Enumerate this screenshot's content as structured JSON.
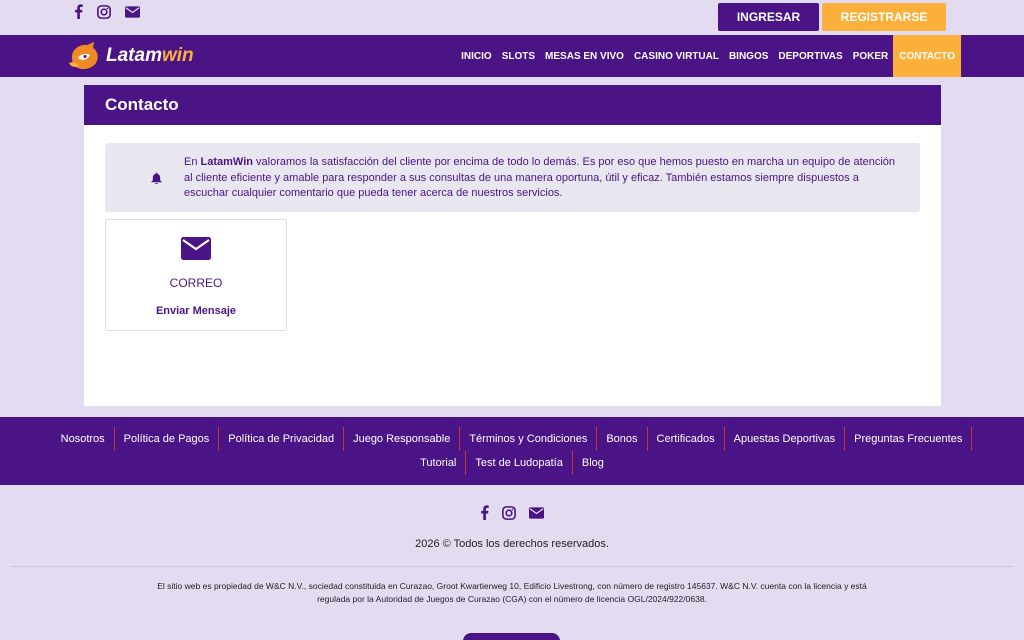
{
  "topbar": {
    "ingresar_label": "INGRESAR",
    "registrarse_label": "REGISTRARSE",
    "social_icons": [
      "facebook-icon",
      "instagram-icon",
      "envelope-icon"
    ]
  },
  "brand": {
    "name_part1": "Latam",
    "name_part2": "win",
    "accent": "#fbb03b",
    "primary": "#4a1487"
  },
  "nav": {
    "items": [
      {
        "label": "INICIO"
      },
      {
        "label": "SLOTS"
      },
      {
        "label": "MESAS EN VIVO"
      },
      {
        "label": "CASINO VIRTUAL"
      },
      {
        "label": "BINGOS"
      },
      {
        "label": "DEPORTIVAS"
      },
      {
        "label": "POKER"
      },
      {
        "label": "CONTACTO",
        "active": true
      }
    ]
  },
  "page": {
    "title": "Contacto",
    "notice_prefix": "En ",
    "notice_brand": "LatamWin",
    "notice_body": " valoramos la satisfacción del cliente por encima de todo lo demás. Es por eso que hemos puesto en marcha un equipo de atención al cliente eficiente y amable para responder a sus consultas de una manera oportuna, útil y eficaz. También estamos siempre dispuestos a escuchar cualquier comentario que pueda tener acerca de nuestros servicios.",
    "contact": {
      "label": "CORREO",
      "action": "Enviar Mensaje"
    }
  },
  "footer": {
    "row1": [
      "Nosotros",
      "Política de Pagos",
      "Política de Privacidad",
      "Juego Responsable",
      "Términos y Condiciones",
      "Bonos",
      "Certificados",
      "Apuestas Deportivas",
      "Preguntas Frecuentes"
    ],
    "row2": [
      "Tutorial",
      "Test de Ludopatía",
      "Blog"
    ],
    "copyright": "2026 © Todos los derechos reservados.",
    "legal": "El sitio web es propiedad de W&C N.V., sociedad constituida en Curazao, Groot Kwartierweg 10, Edificio Livestrong, con número de registro 145637. W&C N.V. cuenta con la licencia y está regulada por la Autoridad de Juegos de Curazao (CGA) con el número de licencia OGL/2024/922/0638."
  }
}
